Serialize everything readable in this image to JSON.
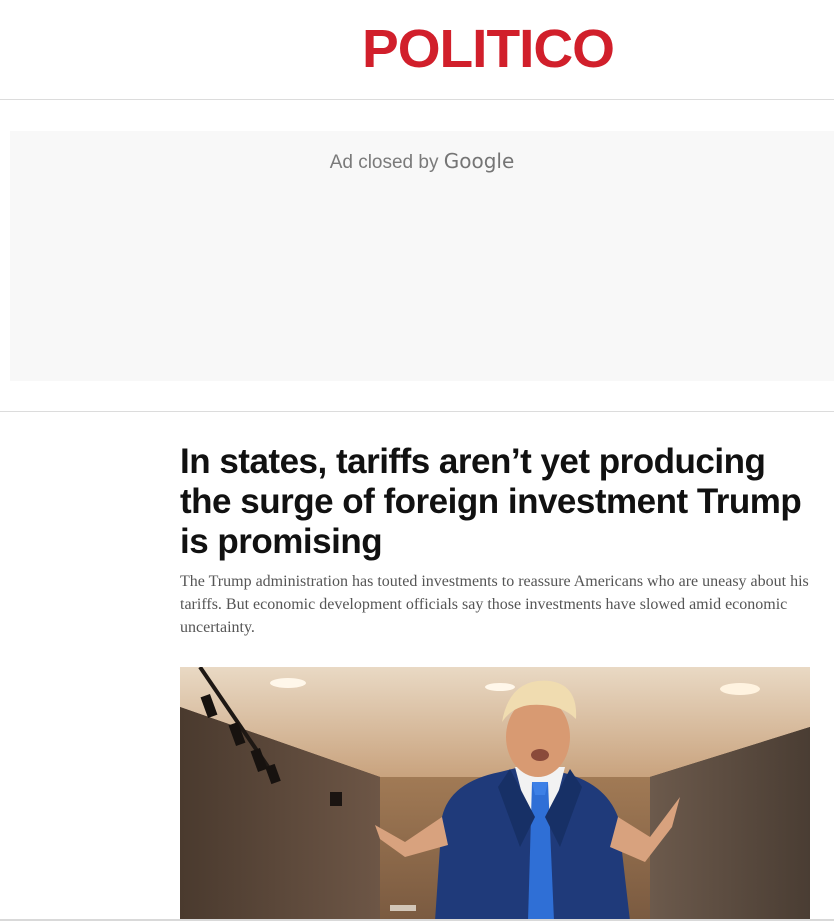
{
  "site": {
    "logo_text": "POLITICO",
    "brand_color": "#d11f2b"
  },
  "ad": {
    "closed_text": "Ad closed by",
    "provider": "Google"
  },
  "article": {
    "headline": "In states, tariffs aren’t yet producing the surge of foreign investment Trump is promising",
    "dek": "The Trump administration has touted investments to reassure Americans who are uneasy about his tariffs. But economic development officials say those investments have slowed amid economic uncertainty."
  }
}
